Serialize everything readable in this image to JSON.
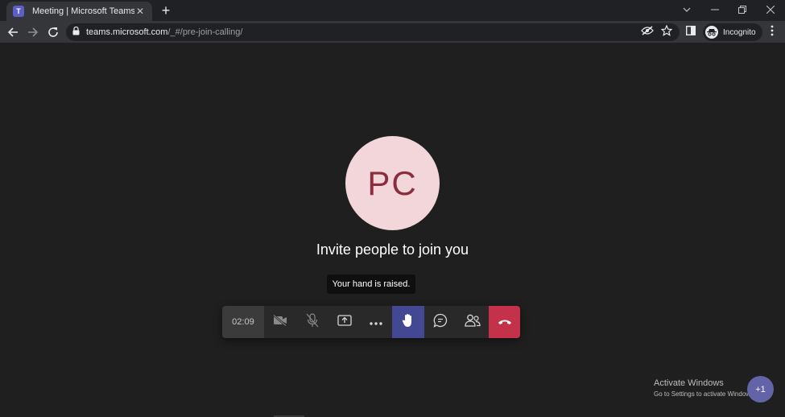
{
  "browser": {
    "tab_title": "Meeting | Microsoft Teams",
    "tab_favicon_letter": "T",
    "url_host": "teams.microsoft.com",
    "url_path": "/_#/pre-join-calling/",
    "incognito_label": "Incognito"
  },
  "meeting": {
    "avatar_initials": "PC",
    "invite_text": "Invite people to join you",
    "tooltip": "Your hand is raised.",
    "timer": "02:09"
  },
  "windows": {
    "activate_title": "Activate Windows",
    "activate_sub": "Go to Settings to activate Windows.",
    "badge": "+1"
  },
  "colors": {
    "teams_purple": "#444791",
    "hangup_red": "#c4314b",
    "avatar_bg": "#f2d6d9",
    "avatar_text": "#8b2d3d"
  }
}
